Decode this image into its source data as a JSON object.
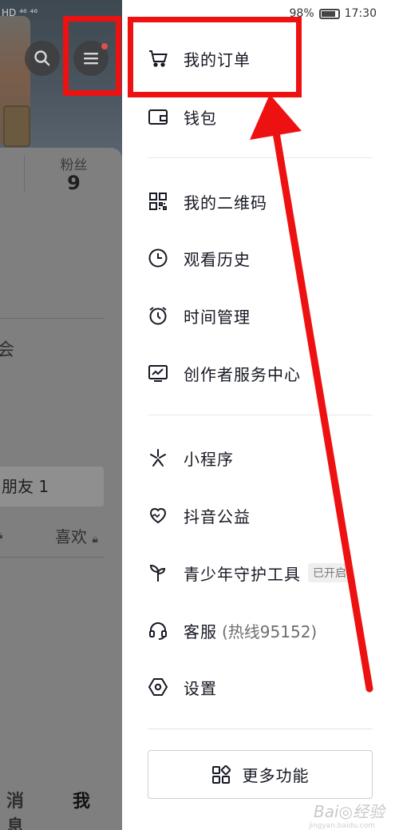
{
  "status_bar": {
    "time": "17:30",
    "battery": "98%",
    "left_indicators": "HD ⁴⁶ ⁴⁶"
  },
  "profile_bg": {
    "fans_label": "粉丝",
    "fans_count": "9",
    "partial_text": "会",
    "friends_tab": "朋友 1",
    "likes_tab": "喜欢",
    "bottom_tab_messages": "消息",
    "bottom_tab_me": "我"
  },
  "drawer": {
    "items": [
      {
        "label": "我的订单",
        "icon": "cart-icon"
      },
      {
        "label": "钱包",
        "icon": "wallet-icon"
      },
      {
        "label": "我的二维码",
        "icon": "qrcode-icon"
      },
      {
        "label": "观看历史",
        "icon": "clock-icon"
      },
      {
        "label": "时间管理",
        "icon": "alarm-icon"
      },
      {
        "label": "创作者服务中心",
        "icon": "chart-icon"
      },
      {
        "label": "小程序",
        "icon": "sparkle-icon"
      },
      {
        "label": "抖音公益",
        "icon": "heart-icon"
      },
      {
        "label": "青少年守护工具",
        "badge": "已开启",
        "icon": "sprout-icon"
      },
      {
        "label": "客服",
        "sub": "(热线95152)",
        "icon": "headset-icon"
      },
      {
        "label": "设置",
        "icon": "settings-icon"
      }
    ],
    "more_button": "更多功能"
  },
  "watermark": {
    "text": "Bai◎经验",
    "sub": "jingyan.baidu.com"
  },
  "colors": {
    "highlight": "#ee1111",
    "drawer_bg": "#ffffff",
    "text": "#161823"
  }
}
